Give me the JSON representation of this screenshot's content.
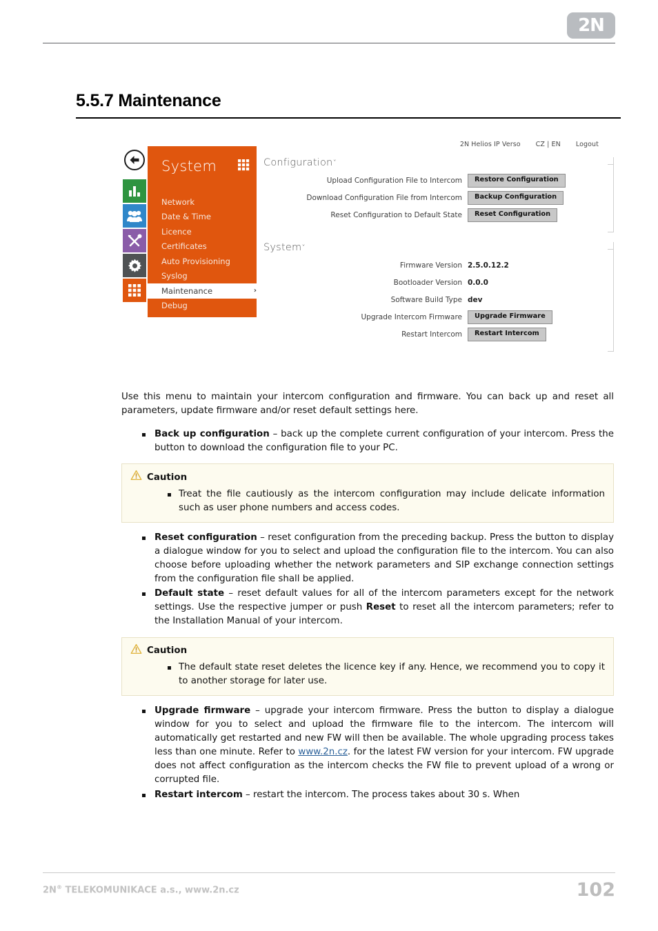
{
  "header": {
    "logo_text": "2N"
  },
  "section": {
    "number_title": "5.5.7 Maintenance"
  },
  "screenshot": {
    "topbar": {
      "product": "2N Helios IP Verso",
      "lang": "CZ | EN",
      "logout": "Logout"
    },
    "menu": {
      "title": "System",
      "items": [
        {
          "label": "Network",
          "active": false
        },
        {
          "label": "Date & Time",
          "active": false
        },
        {
          "label": "Licence",
          "active": false
        },
        {
          "label": "Certificates",
          "active": false
        },
        {
          "label": "Auto Provisioning",
          "active": false
        },
        {
          "label": "Syslog",
          "active": false
        },
        {
          "label": "Maintenance",
          "active": true,
          "chevron": "›"
        },
        {
          "label": "Debug",
          "active": false
        }
      ]
    },
    "rail_icons": [
      {
        "name": "stats-icon",
        "color": "#2e9440"
      },
      {
        "name": "users-icon",
        "color": "#2f87c9"
      },
      {
        "name": "tools-icon",
        "color": "#8a5ca8"
      },
      {
        "name": "gear-icon",
        "color": "#4f5254"
      },
      {
        "name": "grid-icon",
        "color": "#e0560e"
      }
    ],
    "configuration_section": {
      "legend": "Configuration",
      "caret": "ˇ",
      "rows": [
        {
          "label": "Upload Configuration File to Intercom",
          "button": "Restore Configuration"
        },
        {
          "label": "Download Configuration File from Intercom",
          "button": "Backup Configuration"
        },
        {
          "label": "Reset Configuration to Default State",
          "button": "Reset Configuration"
        }
      ]
    },
    "system_section": {
      "legend": "System",
      "caret": "ˇ",
      "rows": [
        {
          "label": "Firmware Version",
          "value": "2.5.0.12.2"
        },
        {
          "label": "Bootloader Version",
          "value": "0.0.0"
        },
        {
          "label": "Software Build Type",
          "value": "dev"
        },
        {
          "label": "Upgrade Intercom Firmware",
          "button": "Upgrade Firmware"
        },
        {
          "label": "Restart Intercom",
          "button": "Restart Intercom"
        }
      ]
    }
  },
  "body": {
    "intro": "Use this menu to maintain your intercom configuration and firmware. You can back up and reset all parameters, update firmware and/or reset default settings here.",
    "bullet_backup_term": "Back up configuration",
    "bullet_backup_text": " – back up the complete current configuration of your intercom. Press the button to download the configuration file to your PC.",
    "caution1": {
      "title": "Caution",
      "item": "Treat the file cautiously as the intercom configuration may include delicate information such as user phone numbers and access codes."
    },
    "bullet_reset_term": "Reset configuration",
    "bullet_reset_text": " – reset configuration from the preceding backup. Press the button to display a dialogue window for you to select and upload the configuration file to the intercom. You can also choose before uploading whether the network parameters and SIP exchange connection settings from the configuration file shall be applied.",
    "bullet_default_term": "Default state",
    "bullet_default_text_a": " – reset default values for all of the intercom parameters except for the network settings. Use the respective jumper or push ",
    "bullet_default_reset_word": "Reset",
    "bullet_default_text_b": " to reset all the intercom parameters; refer to the Installation Manual of your intercom.",
    "caution2": {
      "title": "Caution",
      "item": "The default state reset deletes the licence key if any. Hence, we recommend you to copy it to another storage for later use."
    },
    "bullet_upgrade_term": "Upgrade firmware",
    "bullet_upgrade_text_a": " – upgrade your intercom firmware. Press the button to display a dialogue window for you to select and upload the firmware file to the intercom. The intercom will automatically get restarted and new FW will then be available. The whole upgrading process takes less than one minute. Refer to ",
    "bullet_upgrade_link": "www.2n.cz",
    "bullet_upgrade_text_b": ". for the latest FW version for your intercom. FW upgrade does not affect configuration as the intercom checks the FW file to prevent upload of a wrong or corrupted file.",
    "bullet_restart_term": "Restart intercom",
    "bullet_restart_text": " – restart the intercom. The process takes about 30 s. When"
  },
  "footer": {
    "company": "2N",
    "registered": "®",
    "company_rest": " TELEKOMUNIKACE a.s., www.2n.cz",
    "page_number": "102"
  }
}
